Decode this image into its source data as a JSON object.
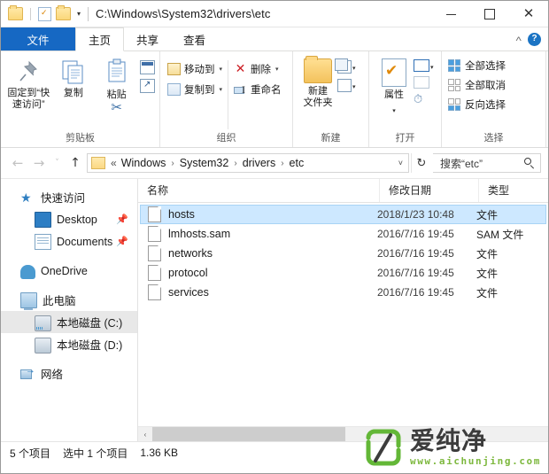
{
  "window": {
    "title": "C:\\Windows\\System32\\drivers\\etc",
    "quick_access": {
      "folder_icon": "folder-icon",
      "properties_icon": "properties-icon",
      "new_folder_icon": "new-folder-icon",
      "customize_caret": "▾"
    },
    "controls": {
      "minimize": "─",
      "maximize": "☐",
      "close": "✕"
    }
  },
  "tabs": [
    {
      "label": "文件",
      "state": "file"
    },
    {
      "label": "主页",
      "state": "active"
    },
    {
      "label": "共享",
      "state": "normal"
    },
    {
      "label": "查看",
      "state": "normal"
    }
  ],
  "tab_right": {
    "collapse_icon": "chevron-up-icon",
    "collapse_glyph": "˄",
    "help_label": "?"
  },
  "ribbon": {
    "groups": [
      {
        "name": "clipboard",
        "label": "剪贴板",
        "buttons": [
          {
            "label": "固定到“快速访问”",
            "line1": "固定到“快",
            "line2": "速访问”",
            "icon": "pin-icon"
          },
          {
            "label": "复制",
            "icon": "copy-icon"
          },
          {
            "label": "粘贴",
            "icon": "paste-icon"
          }
        ],
        "small_buttons": [
          {
            "label": "剪切",
            "icon": "cut-icon"
          },
          {
            "label": "复制路径",
            "icon": "copy-path-icon"
          },
          {
            "label": "粘贴快捷方式",
            "icon": "paste-shortcut-icon"
          }
        ]
      },
      {
        "name": "organize",
        "label": "组织",
        "items": [
          {
            "label": "移动到",
            "icon": "move-to-icon",
            "caret": "▾"
          },
          {
            "label": "复制到",
            "icon": "copy-to-icon",
            "caret": "▾"
          },
          {
            "label": "删除",
            "icon": "delete-icon",
            "caret": "▾"
          },
          {
            "label": "重命名",
            "icon": "rename-icon",
            "caret": ""
          }
        ]
      },
      {
        "name": "new",
        "label": "新建",
        "buttons": [
          {
            "line1": "新建",
            "line2": "文件夹",
            "label": "新建文件夹",
            "icon": "new-folder-icon"
          }
        ],
        "small_buttons": [
          {
            "label": "新建项目",
            "icon": "new-item-icon",
            "caret": "▾"
          },
          {
            "label": "轻松访问",
            "icon": "easy-access-icon",
            "caret": "▾"
          }
        ]
      },
      {
        "name": "open",
        "label": "打开",
        "buttons": [
          {
            "label": "属性",
            "icon": "properties-icon",
            "caret": "▾"
          }
        ],
        "small_buttons": [
          {
            "label": "打开",
            "icon": "open-icon",
            "caret": "▾"
          },
          {
            "label": "编辑",
            "icon": "edit-icon",
            "caret": ""
          },
          {
            "label": "历史记录",
            "icon": "history-icon",
            "caret": ""
          }
        ]
      },
      {
        "name": "select",
        "label": "选择",
        "items": [
          {
            "label": "全部选择",
            "icon": "select-all-icon"
          },
          {
            "label": "全部取消",
            "icon": "select-none-icon"
          },
          {
            "label": "反向选择",
            "icon": "invert-selection-icon"
          }
        ]
      }
    ]
  },
  "address_bar": {
    "back_icon": "back-arrow-icon",
    "forward_icon": "forward-arrow-icon",
    "recent_icon": "recent-locations-icon",
    "up_icon": "up-arrow-icon",
    "back_glyph": "←",
    "forward_glyph": "→",
    "recent_glyph": "˅",
    "up_glyph": "↑",
    "folder_icon": "folder-icon",
    "overflow": "«",
    "crumbs": [
      "Windows",
      "System32",
      "drivers",
      "etc"
    ],
    "separator": "›",
    "dropdown_glyph": "˅",
    "refresh_glyph": "↻",
    "refresh_icon": "refresh-icon",
    "search_placeholder": "搜索“etc”",
    "search_icon": "search-icon"
  },
  "nav_pane": {
    "items": [
      {
        "label": "快速访问",
        "icon": "quick-access-star-icon",
        "indent": false,
        "selected": false,
        "pinned": false
      },
      {
        "label": "Desktop",
        "icon": "desktop-icon",
        "indent": true,
        "selected": false,
        "pinned": true
      },
      {
        "label": "Documents",
        "icon": "documents-icon",
        "indent": true,
        "selected": false,
        "pinned": true
      },
      {
        "label": "OneDrive",
        "icon": "onedrive-cloud-icon",
        "indent": false,
        "selected": false,
        "pinned": false
      },
      {
        "label": "此电脑",
        "icon": "this-pc-icon",
        "indent": false,
        "selected": false,
        "pinned": false
      },
      {
        "label": "本地磁盘 (C:)",
        "icon": "local-disk-c-icon",
        "indent": true,
        "selected": true,
        "pinned": false
      },
      {
        "label": "本地磁盘 (D:)",
        "icon": "local-disk-d-icon",
        "indent": true,
        "selected": false,
        "pinned": false
      },
      {
        "label": "网络",
        "icon": "network-icon",
        "indent": false,
        "selected": false,
        "pinned": false
      }
    ],
    "pin_glyph": "📌"
  },
  "file_list": {
    "columns": [
      {
        "key": "name",
        "label": "名称"
      },
      {
        "key": "date",
        "label": "修改日期"
      },
      {
        "key": "type",
        "label": "类型"
      }
    ],
    "rows": [
      {
        "name": "hosts",
        "date": "2018/1/23 10:48",
        "type": "文件",
        "selected": true
      },
      {
        "name": "lmhosts.sam",
        "date": "2016/7/16 19:45",
        "type": "SAM 文件",
        "selected": false
      },
      {
        "name": "networks",
        "date": "2016/7/16 19:45",
        "type": "文件",
        "selected": false
      },
      {
        "name": "protocol",
        "date": "2016/7/16 19:45",
        "type": "文件",
        "selected": false
      },
      {
        "name": "services",
        "date": "2016/7/16 19:45",
        "type": "文件",
        "selected": false
      }
    ],
    "scroll_left_glyph": "‹",
    "scroll_right_glyph": "›"
  },
  "status_bar": {
    "item_count": "5 个项目",
    "selection": "选中 1 个项目",
    "size": "1.36 KB"
  },
  "watermark": {
    "brand": "爱纯净",
    "url": "www.aichunjing.com",
    "color": "#7db83e"
  },
  "colors": {
    "file_tab_blue": "#1668c3",
    "selection_blue": "#cde8ff",
    "selection_border": "#a8d4f5",
    "nav_selected_gray": "#e8e8e8",
    "brand_green": "#7db83e"
  }
}
